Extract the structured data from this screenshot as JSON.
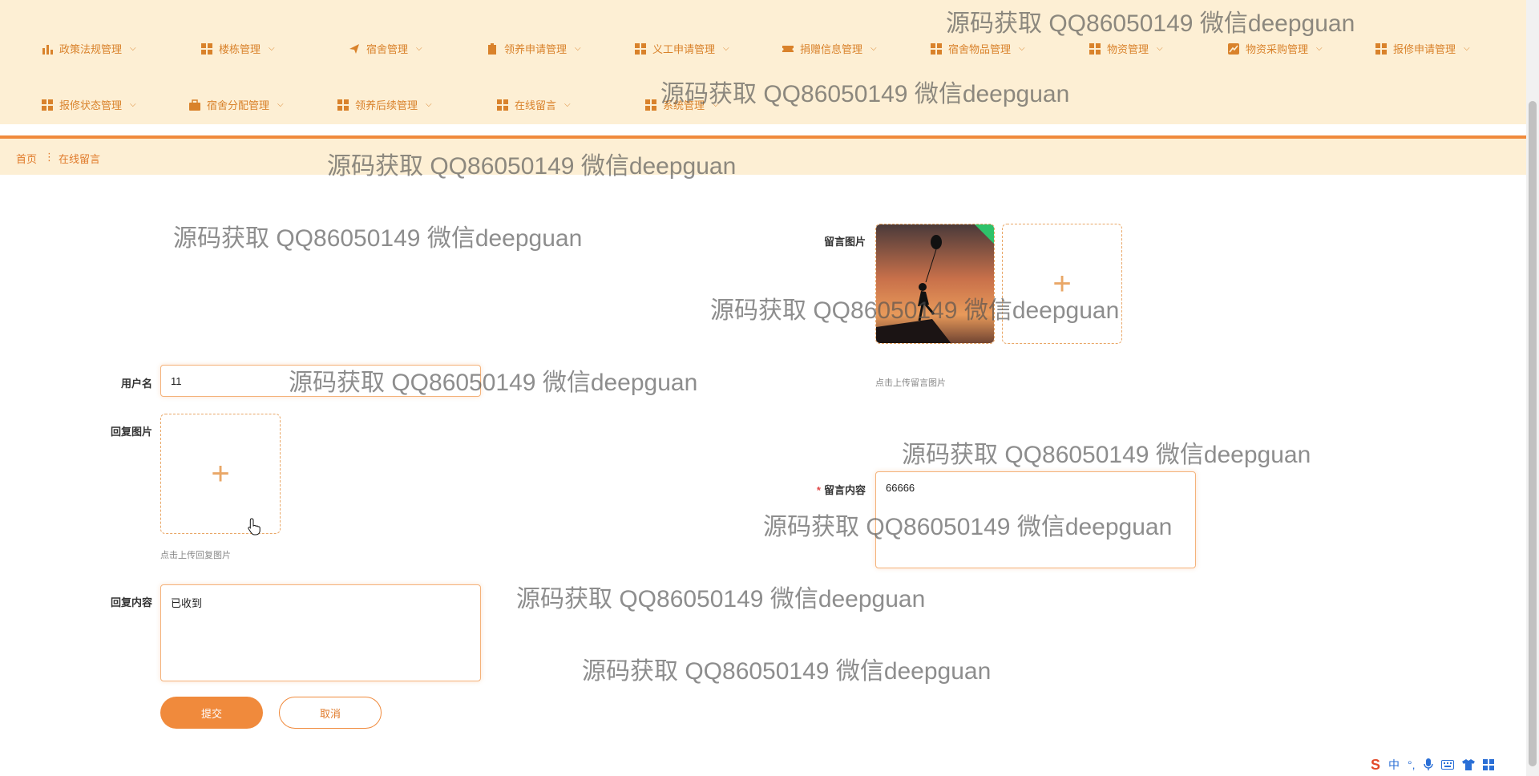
{
  "nav": {
    "row1": [
      {
        "label": "政策法规管理",
        "icon": "bar-chart-icon"
      },
      {
        "label": "楼栋管理",
        "icon": "grid-icon"
      },
      {
        "label": "宿舍管理",
        "icon": "paper-plane-icon"
      },
      {
        "label": "领养申请管理",
        "icon": "clipboard-icon"
      },
      {
        "label": "义工申请管理",
        "icon": "grid-icon"
      },
      {
        "label": "捐赠信息管理",
        "icon": "ticket-icon"
      },
      {
        "label": "宿舍物品管理",
        "icon": "grid-icon"
      },
      {
        "label": "物资管理",
        "icon": "grid-icon"
      },
      {
        "label": "物资采购管理",
        "icon": "line-chart-icon"
      },
      {
        "label": "报修申请管理",
        "icon": "grid-icon"
      }
    ],
    "row2": [
      {
        "label": "报修状态管理",
        "icon": "grid-icon"
      },
      {
        "label": "宿舍分配管理",
        "icon": "briefcase-icon"
      },
      {
        "label": "领养后续管理",
        "icon": "grid-icon"
      },
      {
        "label": "在线留言",
        "icon": "grid-icon"
      },
      {
        "label": "系统管理",
        "icon": "grid-icon"
      }
    ]
  },
  "breadcrumb": {
    "home": "首页",
    "separator": "⋮",
    "current": "在线留言"
  },
  "form": {
    "username_label": "用户名",
    "username_value": "11",
    "message_image_label": "留言图片",
    "message_image_hint": "点击上传留言图片",
    "reply_image_label": "回复图片",
    "reply_image_hint": "点击上传回复图片",
    "message_content_label": "留言内容",
    "message_content_value": "66666",
    "reply_content_label": "回复内容",
    "reply_content_value": "已收到",
    "submit": "提交",
    "cancel": "取消"
  },
  "watermark": "源码获取 QQ86050149 微信deepguan",
  "ime": {
    "logo": "S",
    "lang": "中",
    "punct": "°,",
    "icons": [
      "mic-icon",
      "keyboard-icon",
      "shirt-icon",
      "grid-icon"
    ]
  },
  "colors": {
    "accent": "#f08a3c",
    "nav_bg": "#fdefd4"
  }
}
